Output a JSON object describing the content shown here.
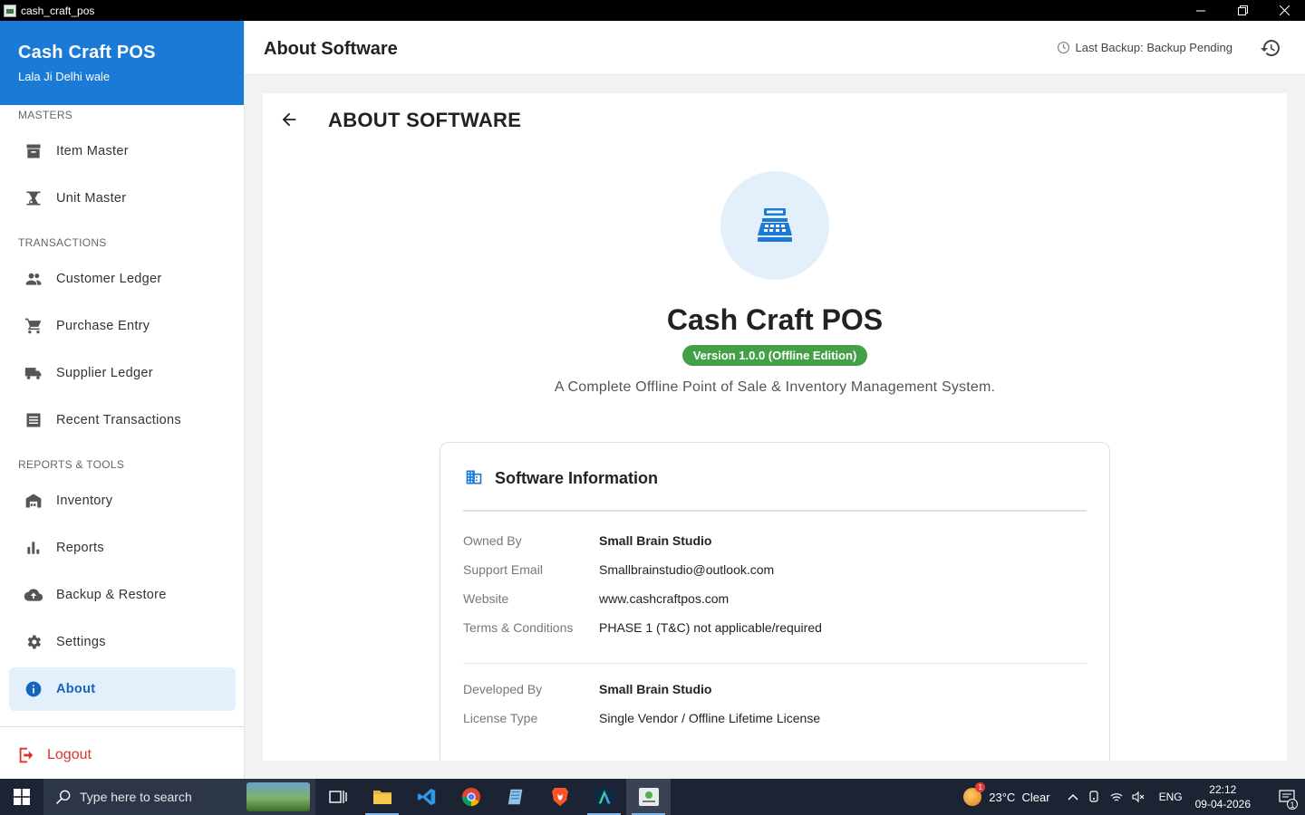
{
  "window": {
    "title": "cash_craft_pos"
  },
  "sidebar": {
    "brand_name": "Cash Craft POS",
    "brand_sub": "Lala Ji Delhi wale",
    "sections": {
      "masters": "MASTERS",
      "transactions": "TRANSACTIONS",
      "reports": "REPORTS & TOOLS"
    },
    "items": [
      {
        "label": "Item Master",
        "icon": "archive-icon"
      },
      {
        "label": "Unit Master",
        "icon": "scale-icon"
      },
      {
        "label": "Customer Ledger",
        "icon": "people-icon"
      },
      {
        "label": "Purchase Entry",
        "icon": "cart-icon"
      },
      {
        "label": "Supplier Ledger",
        "icon": "truck-icon"
      },
      {
        "label": "Recent Transactions",
        "icon": "receipt-list-icon"
      },
      {
        "label": "Inventory",
        "icon": "warehouse-icon"
      },
      {
        "label": "Reports",
        "icon": "bar-chart-icon"
      },
      {
        "label": "Backup & Restore",
        "icon": "cloud-upload-icon"
      },
      {
        "label": "Settings",
        "icon": "gear-icon"
      },
      {
        "label": "About",
        "icon": "info-icon"
      }
    ],
    "active": "About",
    "logout_label": "Logout"
  },
  "header": {
    "title": "About Software",
    "backup_status": "Last Backup: Backup Pending"
  },
  "about": {
    "heading": "ABOUT SOFTWARE",
    "app_name": "Cash Craft POS",
    "version": "Version 1.0.0 (Offline Edition)",
    "tagline": "A Complete Offline Point of Sale & Inventory Management System.",
    "info_title": "Software Information",
    "rows": [
      {
        "key": "Owned By",
        "value": "Small Brain Studio"
      },
      {
        "key": "Support Email",
        "value": "Smallbrainstudio@outlook.com"
      },
      {
        "key": "Website",
        "value": "www.cashcraftpos.com"
      },
      {
        "key": "Terms & Conditions",
        "value": "PHASE 1 (T&C) not applicable/required"
      },
      {
        "key": "Developed By",
        "value": "Small Brain Studio"
      },
      {
        "key": "License Type",
        "value": "Single Vendor / Offline Lifetime License"
      }
    ]
  },
  "colors": {
    "brand": "#1a7ad6",
    "active_bg": "#e3effb",
    "version_badge": "#43a047",
    "logout": "#d9342b"
  },
  "taskbar": {
    "search_placeholder": "Type here to search",
    "weather": "23°C  Clear",
    "weather_badge": "1",
    "language": "ENG",
    "time": "22:12",
    "date": "09-04-2026",
    "notification_count": "1"
  }
}
